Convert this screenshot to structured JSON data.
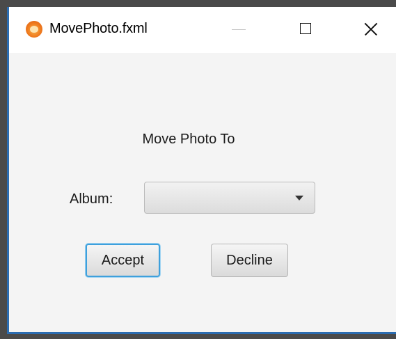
{
  "window": {
    "title": "MovePhoto.fxml",
    "app_icon": "app-icon",
    "controls": [
      "minimize-icon",
      "maximize-icon",
      "close-icon"
    ]
  },
  "dialog": {
    "heading": "Move Photo To",
    "album_label": "Album:",
    "album_value": "",
    "accept_label": "Accept",
    "decline_label": "Decline"
  },
  "colors": {
    "focus_ring": "#3ea0dc",
    "content_bg": "#f4f4f4",
    "window_border": "#2b6cb0"
  }
}
